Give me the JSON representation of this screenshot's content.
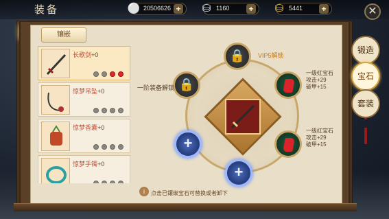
{
  "header": {
    "title": "装备",
    "currencies": [
      {
        "icon": "silver-coin-icon",
        "value": "20506626"
      },
      {
        "icon": "silver-ingot-icon",
        "value": "1160"
      },
      {
        "icon": "gold-ingot-icon",
        "value": "5441"
      }
    ],
    "plus": "+",
    "close": "✕"
  },
  "tab": {
    "label": "镶嵌"
  },
  "items": [
    {
      "name": "长歌剑",
      "level": "+0",
      "slots": [
        "grey",
        "grey",
        "red",
        "red"
      ],
      "selected": true
    },
    {
      "name": "惊梦吊坠",
      "level": "+0",
      "slots": [
        "grey",
        "grey",
        "grey",
        "grey"
      ]
    },
    {
      "name": "惊梦香囊",
      "level": "+0",
      "slots": [
        "grey",
        "grey",
        "grey",
        "grey"
      ]
    },
    {
      "name": "惊梦手镯",
      "level": "+0",
      "slots": [
        "grey",
        "grey",
        "grey",
        "grey"
      ]
    }
  ],
  "wheel": {
    "vip_unlock": "VIP5解锁",
    "rank_unlock": "一阶装备解锁",
    "gem_top_right": {
      "name": "一级红宝石",
      "stat1": "攻击+29",
      "stat2": "破甲+15"
    },
    "gem_bottom_right": {
      "name": "一级红宝石",
      "stat1": "攻击+29",
      "stat2": "破甲+15"
    },
    "add": "+"
  },
  "notice": {
    "icon": "i",
    "text": "点击已镶嵌宝石可替换或者卸下"
  },
  "side_tabs": [
    {
      "label": "锻造",
      "active": false
    },
    {
      "label": "宝石",
      "active": true
    },
    {
      "label": "套装",
      "active": false
    }
  ]
}
